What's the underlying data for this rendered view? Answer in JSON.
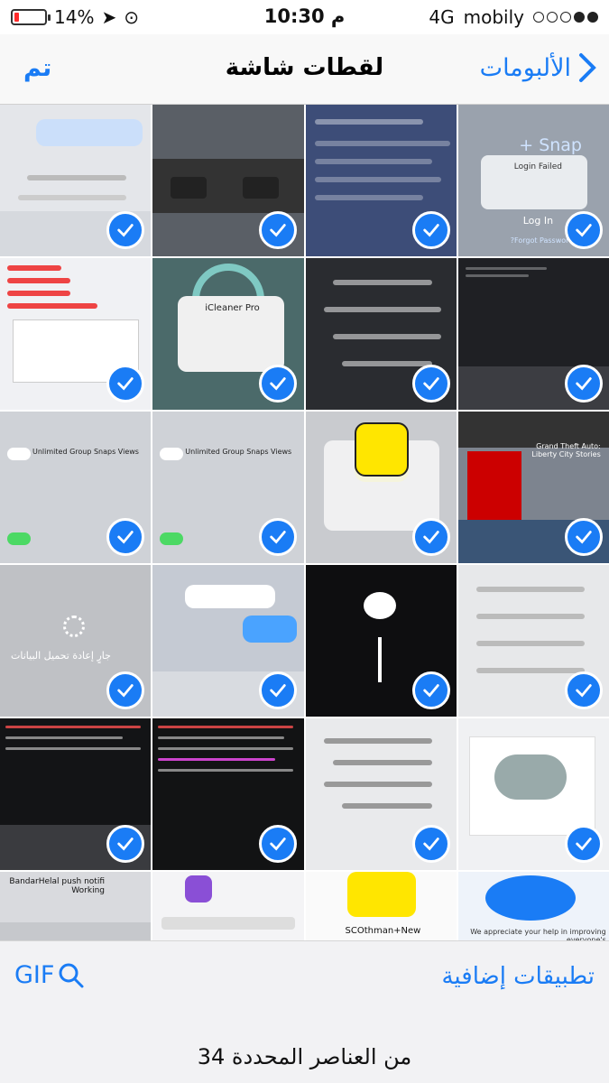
{
  "status_bar": {
    "carrier": "mobily",
    "network": "4G",
    "time": "10:30 م",
    "battery": "14%",
    "battery_level": 0.14,
    "signal_bars": 2
  },
  "nav": {
    "back_label": "الألبومات",
    "title": "لقطات شاشة",
    "done_label": "تم"
  },
  "grid": {
    "selected_count_shown": 20,
    "thumb_texts": {
      "snap_plus": "Snap +",
      "login_failed": "Login Failed",
      "login": "Log In",
      "forgot": "Forgot Password?",
      "icleaner": "iCleaner Pro",
      "unlimited": "Unlimited Group Snaps Views",
      "gta": "Grand Theft Auto: Liberty City Stories",
      "reloading": "جارٍ إعادة تحميل البيانات",
      "scothman": "SCOthman+New",
      "bandar": "BandarHelal push notifi Working",
      "appreciate": "We appreciate your help in improving everyone's"
    }
  },
  "bottom": {
    "gif_label": "GIF",
    "more_apps_label": "تطبيقات إضافية",
    "selection_count": "34 من العناصر المحددة"
  },
  "colors": {
    "accent": "#1a7cf5",
    "battery_low": "#ff2a2a"
  }
}
